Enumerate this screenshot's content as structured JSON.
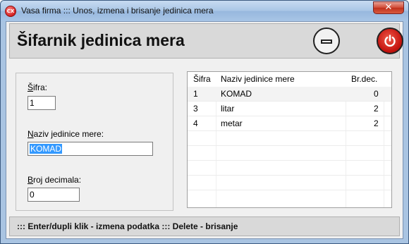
{
  "window": {
    "title": "Vasa firma ::: Unos, izmena i brisanje jedinica mera",
    "icon_text": "CX",
    "close_glyph": "✕"
  },
  "header": {
    "title": "Šifarnik jedinica mera",
    "icons": [
      "minimize-icon",
      "power-icon"
    ],
    "power_color": "#d01a12"
  },
  "form": {
    "sifra": {
      "label_prefix": "Š",
      "label_rest": "ifra:",
      "value": "1"
    },
    "naziv": {
      "label_prefix": "N",
      "label_rest": "aziv jedinice mere:",
      "value": "KOMAD"
    },
    "decimala": {
      "label_prefix": "B",
      "label_rest": "roj decimala:",
      "value": "0"
    }
  },
  "grid": {
    "columns": [
      "Šifra",
      "Naziv jedinice mere",
      "Br.dec."
    ],
    "rows": [
      {
        "sifra": "1",
        "naziv": "KOMAD",
        "brdec": "0"
      },
      {
        "sifra": "3",
        "naziv": "litar",
        "brdec": "2"
      },
      {
        "sifra": "4",
        "naziv": "metar",
        "brdec": "2"
      }
    ],
    "selected_row": 0
  },
  "status": {
    "text": "::: Enter/dupli klik - izmena podatka ::: Delete - brisanje"
  }
}
